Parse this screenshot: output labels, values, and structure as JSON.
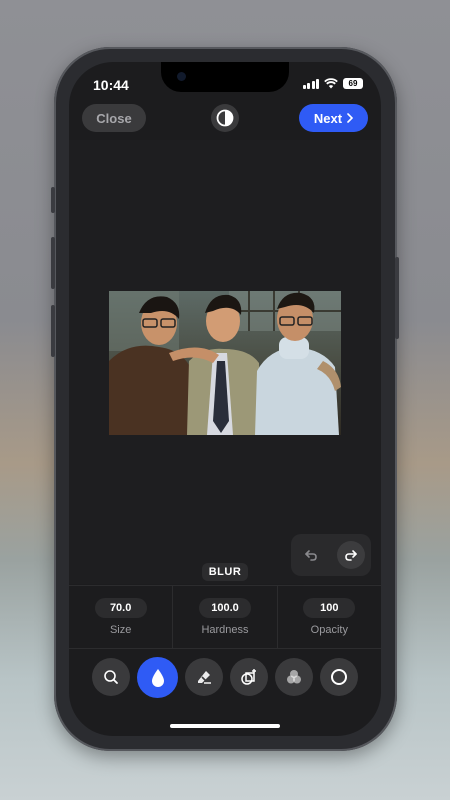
{
  "status_bar": {
    "time": "10:44",
    "battery": "69"
  },
  "toolbar": {
    "close_label": "Close",
    "next_label": "Next",
    "compare_icon": "contrast-icon"
  },
  "canvas": {
    "photo_description_icon": "photo"
  },
  "history": {
    "undo_icon": "undo-icon",
    "redo_icon": "redo-icon"
  },
  "mode": {
    "label": "BLUR"
  },
  "params": [
    {
      "value": "70.0",
      "label": "Size"
    },
    {
      "value": "100.0",
      "label": "Hardness"
    },
    {
      "value": "100",
      "label": "Opacity"
    }
  ],
  "tools": [
    {
      "icon": "search-icon",
      "active": false
    },
    {
      "icon": "drop-icon",
      "active": true
    },
    {
      "icon": "eraser-icon",
      "active": false
    },
    {
      "icon": "add-shape-icon",
      "active": false
    },
    {
      "icon": "circles-icon",
      "active": false
    },
    {
      "icon": "circle-icon",
      "active": false
    }
  ],
  "colors": {
    "accent": "#2f5bf5",
    "background": "#1c1c1e",
    "chip": "#3a3a3c"
  }
}
